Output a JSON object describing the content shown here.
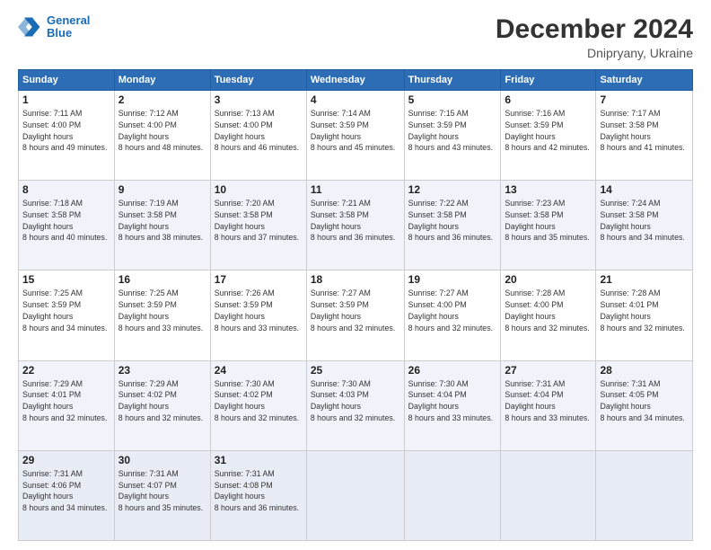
{
  "header": {
    "logo_line1": "General",
    "logo_line2": "Blue",
    "month": "December 2024",
    "location": "Dnipryany, Ukraine"
  },
  "days_of_week": [
    "Sunday",
    "Monday",
    "Tuesday",
    "Wednesday",
    "Thursday",
    "Friday",
    "Saturday"
  ],
  "weeks": [
    [
      {
        "num": "1",
        "rise": "7:11 AM",
        "set": "4:00 PM",
        "daylight": "8 hours and 49 minutes."
      },
      {
        "num": "2",
        "rise": "7:12 AM",
        "set": "4:00 PM",
        "daylight": "8 hours and 48 minutes."
      },
      {
        "num": "3",
        "rise": "7:13 AM",
        "set": "4:00 PM",
        "daylight": "8 hours and 46 minutes."
      },
      {
        "num": "4",
        "rise": "7:14 AM",
        "set": "3:59 PM",
        "daylight": "8 hours and 45 minutes."
      },
      {
        "num": "5",
        "rise": "7:15 AM",
        "set": "3:59 PM",
        "daylight": "8 hours and 43 minutes."
      },
      {
        "num": "6",
        "rise": "7:16 AM",
        "set": "3:59 PM",
        "daylight": "8 hours and 42 minutes."
      },
      {
        "num": "7",
        "rise": "7:17 AM",
        "set": "3:58 PM",
        "daylight": "8 hours and 41 minutes."
      }
    ],
    [
      {
        "num": "8",
        "rise": "7:18 AM",
        "set": "3:58 PM",
        "daylight": "8 hours and 40 minutes."
      },
      {
        "num": "9",
        "rise": "7:19 AM",
        "set": "3:58 PM",
        "daylight": "8 hours and 38 minutes."
      },
      {
        "num": "10",
        "rise": "7:20 AM",
        "set": "3:58 PM",
        "daylight": "8 hours and 37 minutes."
      },
      {
        "num": "11",
        "rise": "7:21 AM",
        "set": "3:58 PM",
        "daylight": "8 hours and 36 minutes."
      },
      {
        "num": "12",
        "rise": "7:22 AM",
        "set": "3:58 PM",
        "daylight": "8 hours and 36 minutes."
      },
      {
        "num": "13",
        "rise": "7:23 AM",
        "set": "3:58 PM",
        "daylight": "8 hours and 35 minutes."
      },
      {
        "num": "14",
        "rise": "7:24 AM",
        "set": "3:58 PM",
        "daylight": "8 hours and 34 minutes."
      }
    ],
    [
      {
        "num": "15",
        "rise": "7:25 AM",
        "set": "3:59 PM",
        "daylight": "8 hours and 34 minutes."
      },
      {
        "num": "16",
        "rise": "7:25 AM",
        "set": "3:59 PM",
        "daylight": "8 hours and 33 minutes."
      },
      {
        "num": "17",
        "rise": "7:26 AM",
        "set": "3:59 PM",
        "daylight": "8 hours and 33 minutes."
      },
      {
        "num": "18",
        "rise": "7:27 AM",
        "set": "3:59 PM",
        "daylight": "8 hours and 32 minutes."
      },
      {
        "num": "19",
        "rise": "7:27 AM",
        "set": "4:00 PM",
        "daylight": "8 hours and 32 minutes."
      },
      {
        "num": "20",
        "rise": "7:28 AM",
        "set": "4:00 PM",
        "daylight": "8 hours and 32 minutes."
      },
      {
        "num": "21",
        "rise": "7:28 AM",
        "set": "4:01 PM",
        "daylight": "8 hours and 32 minutes."
      }
    ],
    [
      {
        "num": "22",
        "rise": "7:29 AM",
        "set": "4:01 PM",
        "daylight": "8 hours and 32 minutes."
      },
      {
        "num": "23",
        "rise": "7:29 AM",
        "set": "4:02 PM",
        "daylight": "8 hours and 32 minutes."
      },
      {
        "num": "24",
        "rise": "7:30 AM",
        "set": "4:02 PM",
        "daylight": "8 hours and 32 minutes."
      },
      {
        "num": "25",
        "rise": "7:30 AM",
        "set": "4:03 PM",
        "daylight": "8 hours and 32 minutes."
      },
      {
        "num": "26",
        "rise": "7:30 AM",
        "set": "4:04 PM",
        "daylight": "8 hours and 33 minutes."
      },
      {
        "num": "27",
        "rise": "7:31 AM",
        "set": "4:04 PM",
        "daylight": "8 hours and 33 minutes."
      },
      {
        "num": "28",
        "rise": "7:31 AM",
        "set": "4:05 PM",
        "daylight": "8 hours and 34 minutes."
      }
    ],
    [
      {
        "num": "29",
        "rise": "7:31 AM",
        "set": "4:06 PM",
        "daylight": "8 hours and 34 minutes."
      },
      {
        "num": "30",
        "rise": "7:31 AM",
        "set": "4:07 PM",
        "daylight": "8 hours and 35 minutes."
      },
      {
        "num": "31",
        "rise": "7:31 AM",
        "set": "4:08 PM",
        "daylight": "8 hours and 36 minutes."
      },
      null,
      null,
      null,
      null
    ]
  ]
}
